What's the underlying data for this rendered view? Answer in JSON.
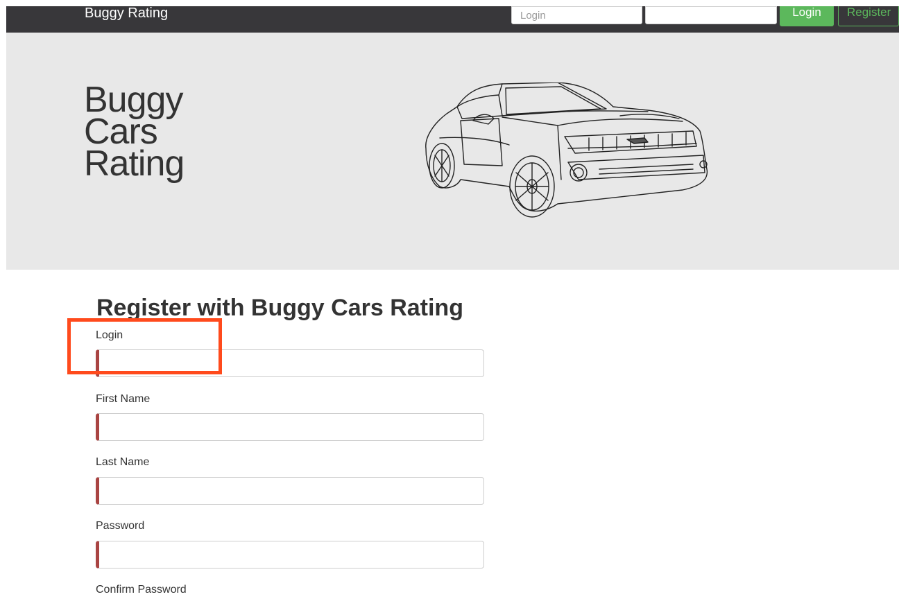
{
  "navbar": {
    "brand": "Buggy Rating",
    "login_placeholder": "Login",
    "password_placeholder": "",
    "login_button": "Login",
    "register_button": "Register"
  },
  "hero": {
    "title_line1": "Buggy",
    "title_line2": "Cars",
    "title_line3": "Rating"
  },
  "form": {
    "heading": "Register with Buggy Cars Rating",
    "fields": [
      {
        "label": "Login",
        "value": ""
      },
      {
        "label": "First Name",
        "value": ""
      },
      {
        "label": "Last Name",
        "value": ""
      },
      {
        "label": "Password",
        "value": ""
      },
      {
        "label": "Confirm Password",
        "value": ""
      }
    ]
  },
  "colors": {
    "navbar_bg": "#38373a",
    "hero_bg": "#e8e8e8",
    "accent_green": "#5cb85c",
    "invalid_border": "#a94442",
    "highlight": "#ff4a1c"
  }
}
